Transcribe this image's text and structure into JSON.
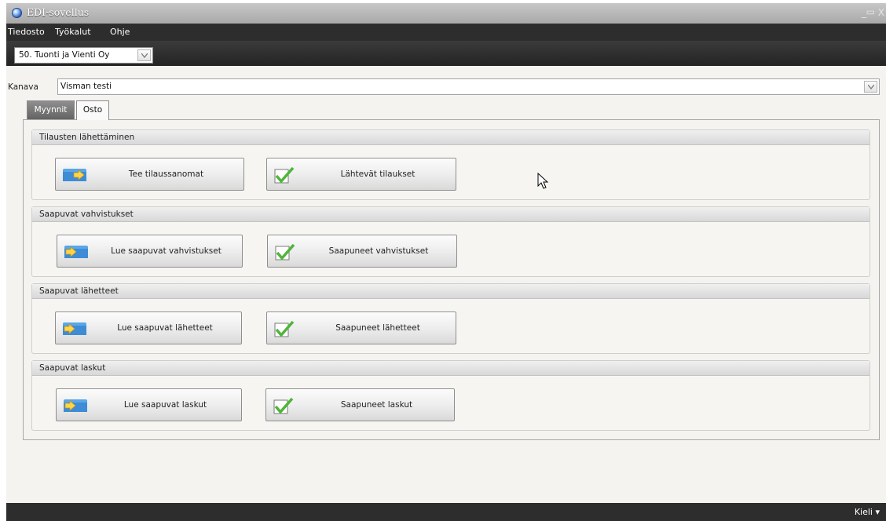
{
  "window": {
    "title": "EDI-sovellus",
    "controls": {
      "minimize": "_",
      "maximize": "▭",
      "close": "X"
    }
  },
  "menu": [
    "Tiedosto",
    "Työkalut",
    "Ohje"
  ],
  "company_select": {
    "value": "50. Tuonti ja Vienti Oy"
  },
  "channel": {
    "label": "Kanava",
    "value": "Visman testi"
  },
  "tabs": [
    {
      "label": "Myynnit",
      "active": false
    },
    {
      "label": "Osto",
      "active": true
    }
  ],
  "groups": [
    {
      "title": "Tilausten lähettäminen",
      "buttons": [
        {
          "label": "Tee tilaussanomat",
          "icon": "folder-arrow-icon"
        },
        {
          "label": "Lähtevät tilaukset",
          "icon": "checkmark-icon"
        }
      ]
    },
    {
      "title": "Saapuvat vahvistukset",
      "buttons": [
        {
          "label": "Lue saapuvat vahvistukset",
          "icon": "folder-arrow-icon"
        },
        {
          "label": "Saapuneet vahvistukset",
          "icon": "checkmark-icon"
        }
      ]
    },
    {
      "title": "Saapuvat lähetteet",
      "buttons": [
        {
          "label": "Lue saapuvat lähetteet",
          "icon": "folder-arrow-icon"
        },
        {
          "label": "Saapuneet lähetteet",
          "icon": "checkmark-icon"
        }
      ]
    },
    {
      "title": "Saapuvat laskut",
      "buttons": [
        {
          "label": "Lue saapuvat laskut",
          "icon": "folder-arrow-icon"
        },
        {
          "label": "Saapuneet laskut",
          "icon": "checkmark-icon"
        }
      ]
    }
  ],
  "statusbar": {
    "language": "Kieli ▾"
  },
  "colors": {
    "titlebar": "#b5b5b5",
    "menubar": "#2d2d2d",
    "panel": "#f4f3ef",
    "check": "#4fb53a"
  }
}
